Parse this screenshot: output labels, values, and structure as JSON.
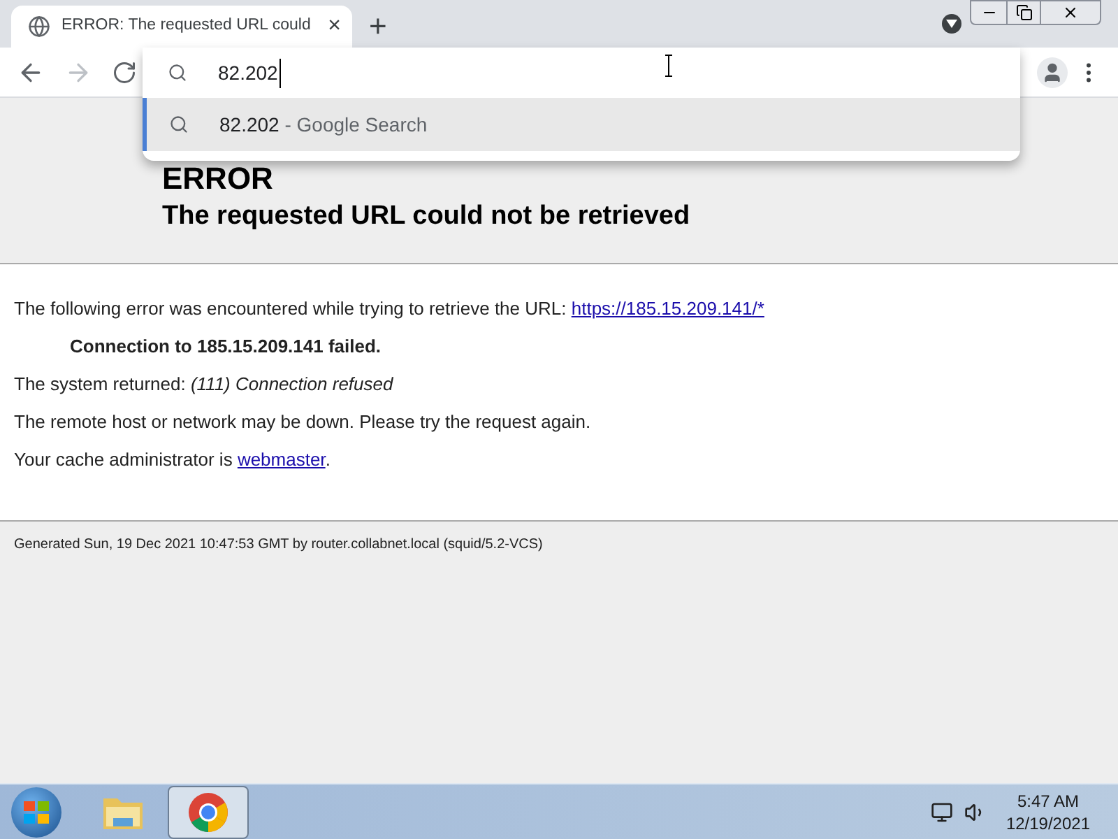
{
  "tab": {
    "title": "ERROR: The requested URL could",
    "close": "×",
    "new_tab": "+"
  },
  "omnibox": {
    "value": "82.202",
    "suggestions": [
      {
        "query": "82.202",
        "suffix": " - Google Search",
        "selected": true
      }
    ]
  },
  "page": {
    "heading": "ERROR",
    "subheading": "The requested URL could not be retrieved",
    "intro": "The following error was encountered while trying to retrieve the URL: ",
    "url": "https://185.15.209.141/*",
    "failure": "Connection to 185.15.209.141 failed.",
    "system_prefix": "The system returned: ",
    "system_error": "(111) Connection refused",
    "remote": "The remote host or network may be down. Please try the request again.",
    "admin_prefix": "Your cache administrator is ",
    "admin_link": "webmaster",
    "admin_suffix": ".",
    "footer": "Generated Sun, 19 Dec 2021 10:47:53 GMT by router.collabnet.local (squid/5.2-VCS)"
  },
  "taskbar": {
    "time": "5:47 AM",
    "date": "12/19/2021"
  }
}
